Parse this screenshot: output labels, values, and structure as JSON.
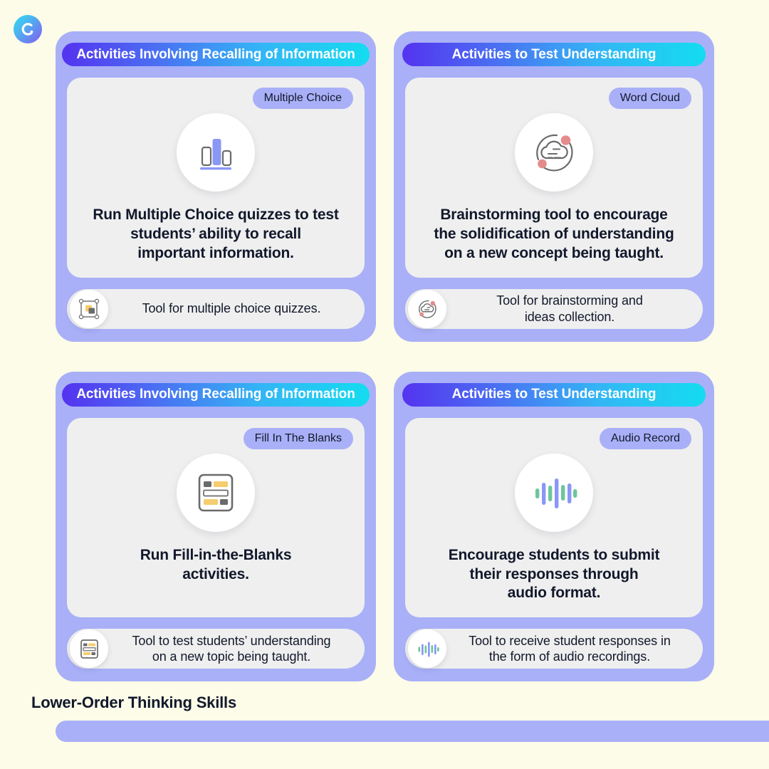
{
  "logo": {
    "name": "brand-logo",
    "glyph": "C.",
    "gradient_from": "#33d6f5",
    "gradient_to": "#7a5cf0"
  },
  "theme": {
    "page_background": "#fcfce8",
    "card_background": "#a9b0f7",
    "panel_background": "#efefef",
    "header_gradient_from": "#5433f0",
    "header_gradient_to": "#14dcf0",
    "text_dark": "#12182b",
    "accent_purple": "#8b97f5",
    "accent_yellow": "#f5d27a",
    "accent_pink": "#e48b8b",
    "accent_green": "#6ec69a",
    "icon_gray": "#6b6b6b"
  },
  "cards": [
    {
      "header": "Activities Involving Recalling of Information",
      "badge": "Multiple Choice",
      "icon": "bar-chart-icon",
      "description": "Run Multiple Choice quizzes to test\nstudents’ ability to recall\nimportant information.",
      "tool_icon": "selection-frame-icon",
      "tool_text": "Tool for multiple choice quizzes."
    },
    {
      "header": "Activities to Test Understanding",
      "badge": "Word Cloud",
      "icon": "cloud-orbit-icon",
      "description": "Brainstorming tool to encourage\nthe solidification of understanding\non a new concept being taught.",
      "tool_icon": "cloud-orbit-icon",
      "tool_text": "Tool for brainstorming and\nideas collection."
    },
    {
      "header": "Activities Involving Recalling of Information",
      "badge": "Fill In The Blanks",
      "icon": "form-blanks-icon",
      "description": "Run Fill-in-the-Blanks\nactivities.",
      "tool_icon": "form-blanks-icon",
      "tool_text": "Tool to test students’ understanding\non a new topic being taught."
    },
    {
      "header": "Activities to Test Understanding",
      "badge": "Audio Record",
      "icon": "audio-waveform-icon",
      "description": "Encourage students to submit\ntheir responses through\naudio format.",
      "tool_icon": "audio-waveform-icon",
      "tool_text": "Tool to receive student responses in\nthe form of audio recordings."
    }
  ],
  "footer": {
    "label": "Lower-Order Thinking Skills"
  }
}
